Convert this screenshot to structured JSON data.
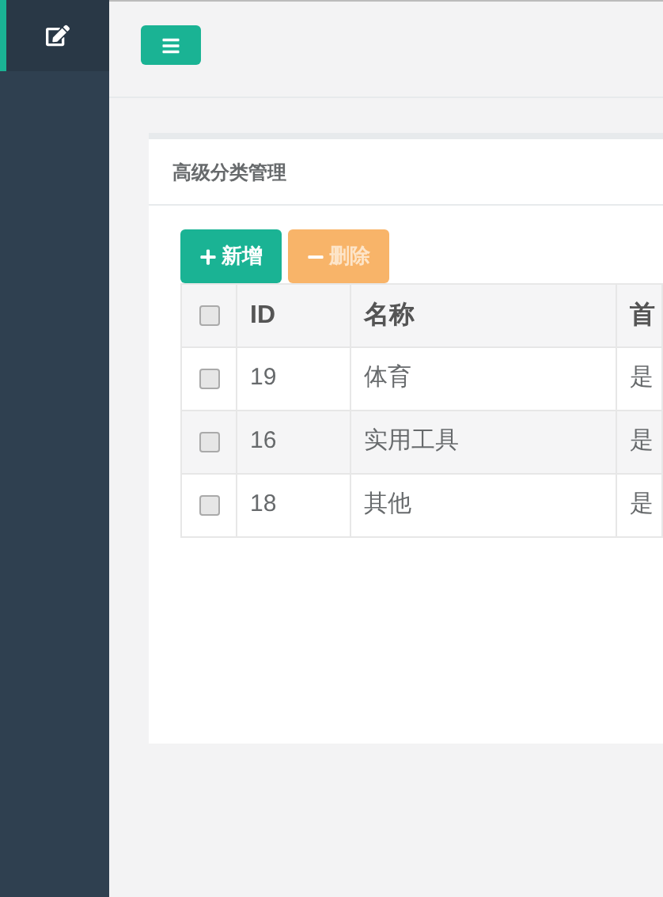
{
  "sidebar": {
    "items": [
      {
        "selected": true
      }
    ]
  },
  "panel": {
    "title": "高级分类管理"
  },
  "toolbar": [
    {
      "label": "新增",
      "kind": "primary",
      "disabled": false
    },
    {
      "label": "删除",
      "kind": "warning",
      "disabled": true
    }
  ],
  "table": {
    "columns": [
      "ID",
      "名称",
      "首"
    ],
    "header_checked": false,
    "rows": [
      {
        "checked": false,
        "cells": [
          "19",
          "体育",
          "是"
        ]
      },
      {
        "checked": false,
        "cells": [
          "16",
          "实用工具",
          "是"
        ]
      },
      {
        "checked": false,
        "cells": [
          "18",
          "其他",
          "是"
        ]
      }
    ]
  }
}
